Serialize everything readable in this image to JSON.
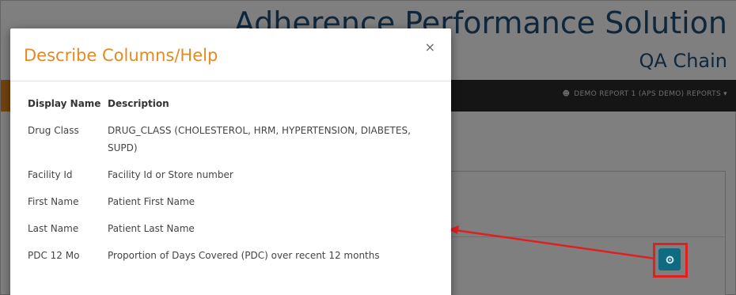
{
  "app": {
    "title": "Adherence Performance Solution",
    "subtitle": "QA Chain",
    "navbar": {
      "user_icon": "user-icon",
      "user_label": "DEMO REPORT 1 (APS DEMO) REPORTS"
    }
  },
  "annotation": {
    "button_icon": "gear-icon",
    "arrow_color": "#e02020"
  },
  "modal": {
    "title": "Describe Columns/Help",
    "close_glyph": "×",
    "headers": {
      "name": "Display Name",
      "description": "Description"
    },
    "rows": [
      {
        "name": "Drug Class",
        "description": "DRUG_CLASS (CHOLESTEROL, HRM, HYPERTENSION, DIABETES, SUPD)"
      },
      {
        "name": "Facility Id",
        "description": "Facility Id or Store number"
      },
      {
        "name": "First Name",
        "description": "Patient First Name"
      },
      {
        "name": "Last Name",
        "description": "Patient Last Name"
      },
      {
        "name": "PDC 12 Mo",
        "description": "Proportion of Days Covered (PDC) over recent 12 months"
      }
    ]
  },
  "colors": {
    "title_orange": "#e48a24",
    "brand_blue": "#1f4e79",
    "nav_dark": "#2b2b2b",
    "button_teal": "#0f6b82",
    "highlight_red": "#e02020"
  }
}
